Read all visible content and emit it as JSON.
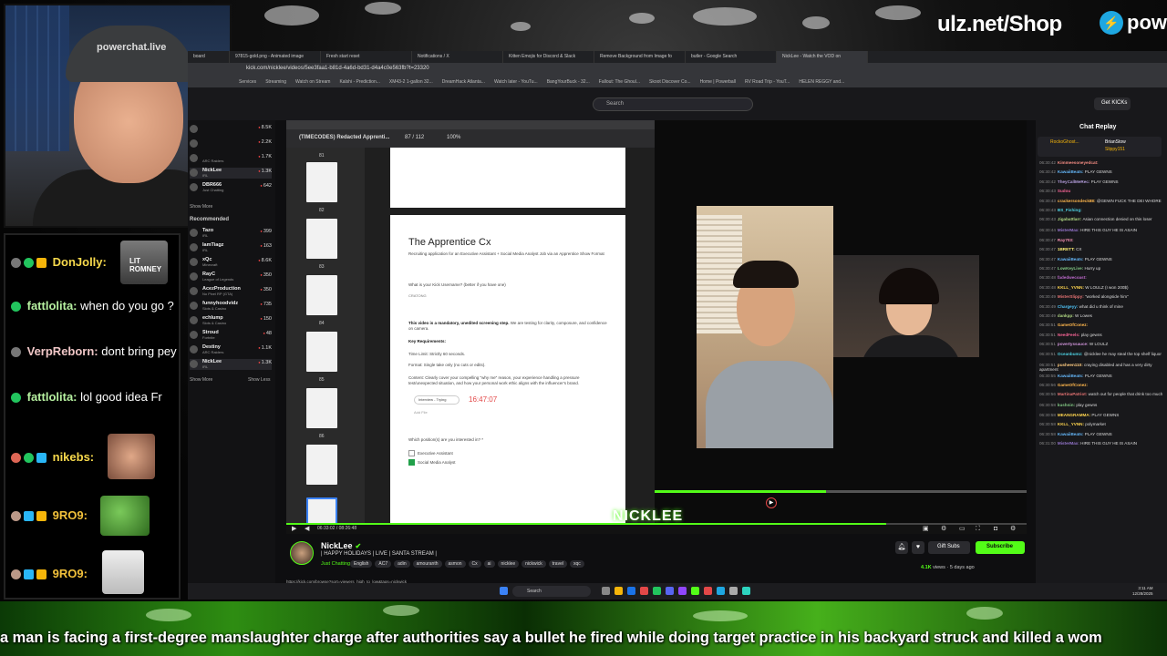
{
  "overlay": {
    "shop_url": "ulz.net/Shop",
    "brand_text": "pow",
    "webcam_cap_text": "powerchat.live",
    "ticker_text": "a man is facing a first-degree manslaughter charge after authorities say a bullet he fired while doing target practice in his backyard struck and killed a wom"
  },
  "chat_overlay": [
    {
      "user": "DonJolly:",
      "text": "",
      "color": "#f7d94c"
    },
    {
      "user": "fattlolita:",
      "text": "when do you go ?",
      "color": "#b6f0a0"
    },
    {
      "user": "VerpReborn:",
      "text": "dont bring pey",
      "color": "#f0c7c7"
    },
    {
      "user": "fattlolita:",
      "text": "lol good idea Fr",
      "color": "#b6f0a0"
    },
    {
      "user": "nikebs:",
      "text": "",
      "color": "#f7d94c"
    },
    {
      "user": "9RO9:",
      "text": "",
      "color": "#f2c13b"
    },
    {
      "user": "9RO9:",
      "text": "",
      "color": "#f2c13b"
    }
  ],
  "emotes": {
    "lit_romney": "LIT ROMNEY"
  },
  "browser": {
    "tabs": [
      "board",
      "97815-gold.png - Animated image",
      "Fresh start reset",
      "Notifications / X",
      "Kitten Emojis for Discord & Slack",
      "Remove Background from Image fo",
      "butler - Google Search",
      "NickLee - Watch the VOD on"
    ],
    "url": "kick.com/nicklee/videos/5ee3faa1-b81d-4a6d-bd31-d4a4c0e563fb?t=23320",
    "bookmarks": [
      "Services",
      "Streaming",
      "Watch on Stream",
      "Kalshi - Prediction...",
      "XM43-2 1-gallon 32...",
      "DreamHack Atlanta...",
      "Watch later - YouTu...",
      "BangYourBuck - 32...",
      "Fallout: The Ghoul...",
      "Skoot Discover Co...",
      "Home | Powerball",
      "RV Road Trip - YouT...",
      "HELEN REGGY and..."
    ]
  },
  "kick": {
    "search_placeholder": "Search",
    "get_kicks": "Get KICKs",
    "sidebar_top": [
      {
        "name": "",
        "cat": "",
        "viewers": "8.5K"
      },
      {
        "name": "",
        "cat": "",
        "viewers": "2.2K"
      },
      {
        "name": "",
        "cat": "ARC Raiders",
        "viewers": "1.7K"
      },
      {
        "name": "NickLee",
        "cat": "IRL",
        "viewers": "1.3K"
      },
      {
        "name": "DBR666",
        "cat": "Just Chatting",
        "viewers": "642"
      }
    ],
    "show_more": "Show More",
    "recommended_label": "Recommended",
    "recommended": [
      {
        "name": "Tazo",
        "cat": "IRL",
        "viewers": "399"
      },
      {
        "name": "IamTiagz",
        "cat": "IRL",
        "viewers": "163"
      },
      {
        "name": "xQc",
        "cat": "Minecraft",
        "viewers": "8.6K"
      },
      {
        "name": "RayC",
        "cat": "League of Legends",
        "viewers": "350"
      },
      {
        "name": "AcezProduction",
        "cat": "No Pixel RP (GTA)",
        "viewers": "350"
      },
      {
        "name": "funnyhoodvidz",
        "cat": "Slots & Casino",
        "viewers": "735"
      },
      {
        "name": "echlump",
        "cat": "Slots & Casino",
        "viewers": "150"
      },
      {
        "name": "Stroud",
        "cat": "Fortnite",
        "viewers": "48"
      },
      {
        "name": "Destiny",
        "cat": "ARC Raiders",
        "viewers": "1.1K"
      },
      {
        "name": "NickLee",
        "cat": "IRL",
        "viewers": "1.3K"
      }
    ],
    "show_less": "Show Less",
    "stream": {
      "name": "NickLee",
      "title": "| HAPPY HOLIDAYS | LIVE | SANTA STREAM |",
      "category": "Just Chatting",
      "tags": [
        "English",
        "AC7",
        "adin",
        "amouranth",
        "asmon",
        "Cx",
        "ai",
        "nicklee",
        "nickwick",
        "travel",
        "xqc"
      ],
      "views": "4.1K",
      "views_label": "views",
      "age": "5 days ago",
      "gift_subs": "Gift Subs",
      "subscribe": "Subscribe"
    },
    "status_url": "https://kick.com/browse?sort=viewers_high_to_low&tags=nickwick"
  },
  "document": {
    "window_title": "(TIMECODES) Redacted Apprenti...",
    "page_counter": "87 / 112",
    "zoom": "100%",
    "thumb_numbers": [
      "81",
      "82",
      "83",
      "84",
      "85",
      "86"
    ],
    "heading": "The Apprentice Cx",
    "subheading": "Recruiting application for an Executive Assistant + Social Media Analyst Job via an Apprentice Show Format",
    "q1": "What is your Kick Username? (better if you have one)",
    "q1_answer": "CRATONG",
    "intro_bold": "This video is a mandatory, unedited screening step.",
    "intro_rest": "We are testing for clarity, composure, and confidence on camera.",
    "key_req": "Key Requirements:",
    "time_limit": "Time Limit: Strictly 60 seconds.",
    "format": "Format: Single take only (no cuts or edits).",
    "content": "Content: Clearly cover your compelling \"why me\" reason, your experience handling a pressure test/unexpected situation, and how your personal work ethic aligns with the influencer's brand.",
    "file_label": "Interview - Trying",
    "add_file": "Add File",
    "timestamp": "16:47:07",
    "q2": "Which position(s) are you interested in? *",
    "opt1": "Executive Assistant",
    "opt2": "Social Media Analyst",
    "opt1_checked": false,
    "opt2_checked": true
  },
  "player": {
    "watermark": "NICKLEE",
    "time": "06:33:02 / 08:26:48",
    "doc_scrub_progress": 0.46,
    "kick_scrub_progress": 0.81
  },
  "chat_replay": {
    "title": "Chat Replay",
    "pinned": [
      "RockoGhost...",
      "BrianStow",
      "Slippy151"
    ],
    "lines": [
      {
        "ts": "06:30:42",
        "user": "Kimmeesoneyedcat:",
        "text": "",
        "color": "#f28b82"
      },
      {
        "ts": "06:30:42",
        "user": "KawaiiBeats:",
        "text": "PLAY GEWNS",
        "color": "#64b5f6"
      },
      {
        "ts": "06:30:42",
        "user": "TheyCallMeRec:",
        "text": "PLAY GEWNS",
        "color": "#b39ddb"
      },
      {
        "ts": "06:30:43",
        "user": "Sudou",
        "text": "",
        "color": "#f06292"
      },
      {
        "ts": "06:30:43",
        "user": "crackersondeck88:",
        "text": "@GEWN FUCK THE DEI WHORE",
        "color": "#ffb74d"
      },
      {
        "ts": "06:30:43",
        "user": "BS_Fishing:",
        "text": "",
        "color": "#4dd0e1"
      },
      {
        "ts": "06:30:43",
        "user": "Jigabattlarr:",
        "text": "Asian connection denied on this loser",
        "color": "#aed581"
      },
      {
        "ts": "06:30:44",
        "user": "MisterMax:",
        "text": "HIRE THIS GUY HE IS ASAIN",
        "color": "#9575cd"
      },
      {
        "ts": "06:30:47",
        "user": "Ray703:",
        "text": "",
        "color": "#f48fb1"
      },
      {
        "ts": "06:30:47",
        "user": "1BRETT:",
        "text": "CX",
        "color": "#fff176"
      },
      {
        "ts": "06:30:47",
        "user": "KawaiiBeats:",
        "text": "PLAY GEWNS",
        "color": "#64b5f6"
      },
      {
        "ts": "06:30:47",
        "user": "LowKeyLive:",
        "text": "Hurry up",
        "color": "#81c784"
      },
      {
        "ts": "06:30:48",
        "user": "fadedwecoast:",
        "text": "",
        "color": "#ba68c8"
      },
      {
        "ts": "06:30:48",
        "user": "KKLL_YVNN:",
        "text": "W LOULZ (I won 200$)",
        "color": "#ffd54f"
      },
      {
        "ts": "06:30:49",
        "user": "MisterSlippy:",
        "text": "\"worked alongside him\"",
        "color": "#e57373"
      },
      {
        "ts": "06:30:49",
        "user": "Chargeyy:",
        "text": "what did u think of mine",
        "color": "#4fc3f7"
      },
      {
        "ts": "06:30:49",
        "user": "dankpp:",
        "text": "W Lowes",
        "color": "#aed581"
      },
      {
        "ts": "06:30:51",
        "user": "GameOfConez:",
        "text": "",
        "color": "#ffb74d"
      },
      {
        "ts": "06:30:51",
        "user": "NeedFeels:",
        "text": "play gewns",
        "color": "#f06292"
      },
      {
        "ts": "06:30:51",
        "user": "povertyssauce:",
        "text": "W LOULZ",
        "color": "#ce93d8"
      },
      {
        "ts": "06:30:51",
        "user": "Oceanbumz:",
        "text": "@nicklee he may steal the top shelf liquor",
        "color": "#4dd0e1"
      },
      {
        "ts": "06:30:51",
        "user": "pusheen110:",
        "text": "craying disabled and has a very dirty apartment",
        "color": "#ffcc80"
      },
      {
        "ts": "06:30:55",
        "user": "KawaiiBeats:",
        "text": "PLAY GEWNS",
        "color": "#64b5f6"
      },
      {
        "ts": "06:30:56",
        "user": "GameOfConez:",
        "text": "",
        "color": "#ffb74d"
      },
      {
        "ts": "06:30:56",
        "user": "MartinaPatriot:",
        "text": "watch out for people that drink too much",
        "color": "#e57373"
      },
      {
        "ts": "06:30:58",
        "user": "kushnin:",
        "text": "play gewns",
        "color": "#81c784"
      },
      {
        "ts": "06:30:58",
        "user": "MEANGRAMMA:",
        "text": "PLAY GEWNS",
        "color": "#ffd54f"
      },
      {
        "ts": "06:30:58",
        "user": "KKLL_YVNN:",
        "text": "polymarket",
        "color": "#ffd54f"
      },
      {
        "ts": "06:30:58",
        "user": "KawaiiBeats:",
        "text": "PLAY GEWNS",
        "color": "#64b5f6"
      },
      {
        "ts": "06:31:00",
        "user": "MisterMax:",
        "text": "HIRE THIS GUY HE IS ASAIN",
        "color": "#9575cd"
      }
    ]
  },
  "taskbar": {
    "search": "Search",
    "time": "3:11 AM",
    "date": "12/28/2025"
  }
}
